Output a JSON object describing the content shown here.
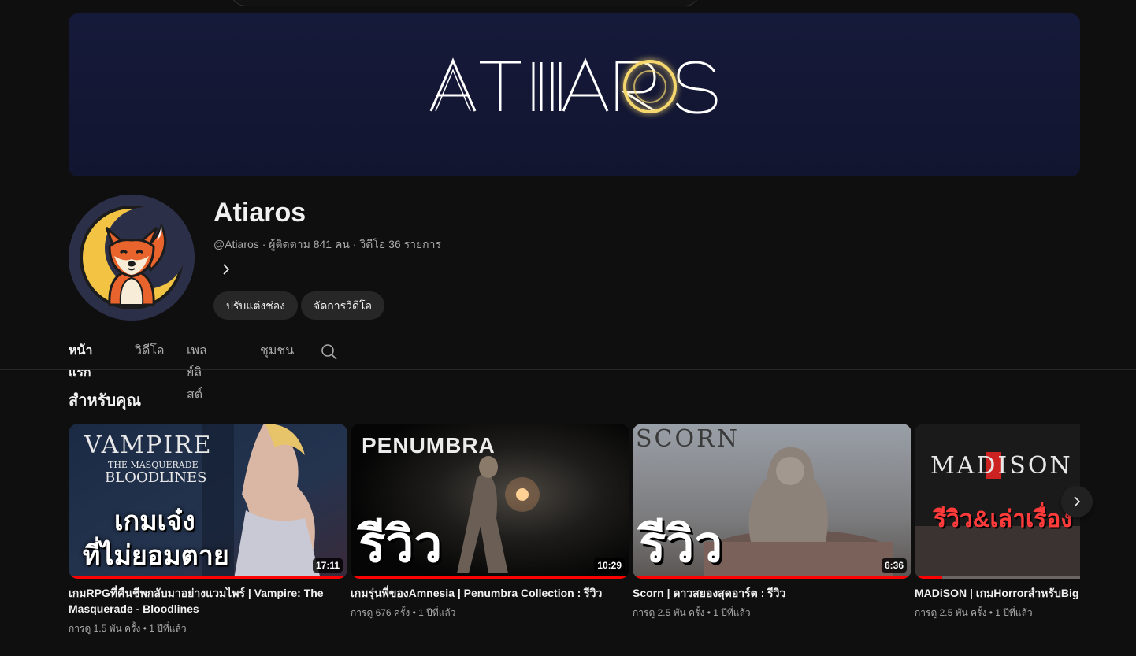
{
  "channel": {
    "name": "Atiaros",
    "handle": "@Atiaros",
    "subscribers": "ผู้ติดตาม 841 คน",
    "videos_count": "วิดีโอ 36 รายการ",
    "separator": "·",
    "banner_text": "ATIAROS"
  },
  "buttons": {
    "customize": "ปรับแต่งช่อง",
    "manage_videos": "จัดการวิดีโอ"
  },
  "tabs": [
    {
      "label": "หน้าแรก",
      "active": true
    },
    {
      "label": "วิดีโอ",
      "active": false
    },
    {
      "label": "เพลย์ลิสต์",
      "active": false
    },
    {
      "label": "ชุมชน",
      "active": false
    }
  ],
  "section": {
    "title": "สำหรับคุณ"
  },
  "videos": [
    {
      "title": "เกมRPGที่คืนชีพกลับมาอย่างแวมไพร์ | Vampire: The Masquerade - Bloodlines",
      "views": "การดู 1.5 พัน ครั้ง",
      "age": "1 ปีที่แล้ว",
      "duration": "17:11",
      "progress": 1.0,
      "thumb_text_1": "VAMPIRE",
      "thumb_text_2": "THE MASQUERADE",
      "thumb_text_3": "BLOODLINES",
      "thumb_text_4": "เกมเจ๋ง",
      "thumb_text_5": "ที่ไม่ยอมตาย"
    },
    {
      "title": "เกมรุ่นพี่ของAmnesia | Penumbra Collection : รีวิว",
      "views": "การดู 676 ครั้ง",
      "age": "1 ปีที่แล้ว",
      "duration": "10:29",
      "progress": 1.0,
      "thumb_text_1": "PENUMBRA",
      "thumb_text_2": "รีวิว"
    },
    {
      "title": "Scorn | ดาวสยองสุดอาร์ต : รีวิว",
      "views": "การดู 2.5 พัน ครั้ง",
      "age": "1 ปีที่แล้ว",
      "duration": "6:36",
      "progress": 1.0,
      "thumb_text_1": "SCORN",
      "thumb_text_2": "รีวิว"
    },
    {
      "title": "MADiSON | เกมHorrorสำหรับBig Brain",
      "views": "การดู 2.5 พัน ครั้ง",
      "age": "1 ปีที่แล้ว",
      "duration": "",
      "progress": 0.1,
      "thumb_text_1": "MADISON",
      "thumb_text_2": "รีวิว&เล่าเรื่อง"
    }
  ],
  "meta_dot": "•",
  "colors": {
    "background": "#0f0f0f",
    "banner": "#141836",
    "accent_gold": "#f5d76e",
    "progress_red": "#ff0000",
    "button_bg": "#272727"
  },
  "icons": {
    "about": "chevron-right-icon",
    "tab_search": "search-icon",
    "next": "chevron-right-icon"
  }
}
